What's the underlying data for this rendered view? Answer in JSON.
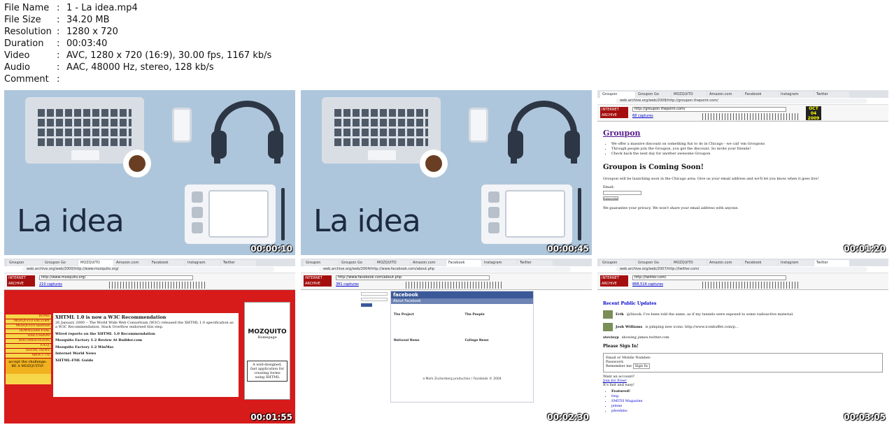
{
  "metadata": [
    {
      "key": "File Name",
      "value": "1 - La idea.mp4"
    },
    {
      "key": "File Size",
      "value": "34.20 MB"
    },
    {
      "key": "Resolution",
      "value": "1280 x 720"
    },
    {
      "key": "Duration",
      "value": "00:03:40"
    },
    {
      "key": "Video",
      "value": "AVC, 1280 x 720 (16:9), 30.00 fps, 1167 kb/s"
    },
    {
      "key": "Audio",
      "value": "AAC, 48000 Hz, stereo, 128 kb/s"
    },
    {
      "key": "Comment",
      "value": ""
    }
  ],
  "thumbnails": [
    {
      "timestamp": "00:00:10",
      "title": "La idea"
    },
    {
      "timestamp": "00:00:45",
      "title": "La idea"
    },
    {
      "timestamp": "00:01:20",
      "tabs": [
        "Groupon",
        "Groupon Go",
        "MOZQUITO",
        "Amazon.com",
        "Facebook",
        "Instagram",
        "Twitter"
      ],
      "address": "web.archive.org/web/2008/http://groupon.thepoint.com/",
      "wayback_url": "http://groupon.thepoint.com/",
      "captures": "68 captures",
      "wayback_date": "OCT 04 2009",
      "heading_link": "Groupon",
      "bullets": [
        "We offer a massive discount on something fun to do in Chicago - we call 'em Groupons",
        "Through people join the Groupon, you get the discount. So invite your friends!",
        "Check back the next day for another awesome Groupon"
      ],
      "heading": "Groupon is Coming Soon!",
      "paragraph": "Groupon will be launching soon in the Chicago area. Give us your email address and we'll let you know when it goes live!",
      "email_label": "Email:",
      "subscribe": "Subscribe",
      "privacy": "We guarantee your privacy. We won't share your email address with anyone."
    },
    {
      "timestamp": "00:01:55",
      "tabs": [
        "Groupon",
        "Groupon Go",
        "MOZQUITO",
        "Amazon.com",
        "Facebook",
        "Instagram",
        "Twitter"
      ],
      "address": "web.archive.org/web/2000/http://www.mozquito.org/",
      "wayback_url": "http://www.mozquito.org/",
      "captures": "210 captures",
      "nav": [
        "HOME",
        "MOZQUITO FACTORY",
        "MOZQUITO SERVER",
        "DOWNLOAD EVAL",
        "DISCUSSION",
        "DOCUMENTATION",
        "F.A.Q.",
        "XHTML NEWS",
        "ABOUT US"
      ],
      "headline": "XHTML 1.0 is now a W3C Recommendation",
      "body": "26 January 2000 -- The World Wide Web Consortium (W3C) released the XHTML 1.0 specification as a W3C Recommendation. Stack Overflow endorsed this step.",
      "item1": "Wired reports on the XHTML 1.0 Recommendation",
      "item2": "Mozquito Factory 1.2 Review At Builder.com",
      "item3": "Mozquito Factory 1.2 WinMac",
      "item4": "Internet World News",
      "item5": "XHTML-FML Guide",
      "logo": "MOZQUITO",
      "logo_sub": "Homepage",
      "ad": "A well-designed, fast application for creating forms using XHTML",
      "challenge": "accept the challenge: BE A MOZQUITO!"
    },
    {
      "timestamp": "00:02:30",
      "tabs": [
        "Groupon",
        "Groupon Go",
        "MOZQUITO",
        "Amazon.com",
        "Facebook",
        "Instagram",
        "Twitter"
      ],
      "address": "web.archive.org/web/2004/http://www.facebook.com/about.php",
      "wayback_url": "http://www.facebook.com/about.php",
      "captures": "381 captures",
      "fb_logo": "facebook",
      "fb_bar": "About Facebook",
      "fb_project": "The Project",
      "fb_people": "The People",
      "fb_national": "National News",
      "fb_college": "College News",
      "fb_footer": "a Mark Zuckerberg production / Facebook © 2004"
    },
    {
      "timestamp": "00:03:05",
      "tabs": [
        "Groupon",
        "Groupon Go",
        "MOZQUITO",
        "Amazon.com",
        "Facebook",
        "Instagram",
        "Twitter"
      ],
      "address": "web.archive.org/web/2007/http://twitter.com/",
      "wayback_url": "http://twitter.com/",
      "captures": "888,514 captures",
      "recent": "Recent Public Updates",
      "u1_name": "Erik",
      "u1_text": "@Snook: I've been told the same, as if my tunnels were exposed to some radioactive material.",
      "u2_name": "Josh Williams",
      "u2_text": "is pimping new icons: http://www.iconbuffet.com/p...",
      "u3_name": "stevieyp",
      "u3_text": "showing james.twitter.com",
      "signin": "Please Sign In!",
      "email_label": "Email or Mobile Number:",
      "password_label": "Password:",
      "remember": "Remember me",
      "signin_btn": "Sign In",
      "want": "Want an account?",
      "join": "Join for Free!",
      "fast": "It's fast and easy!",
      "featured": "Featured!",
      "featured_items": [
        "ting",
        "SMITH Magazine",
        "jelene",
        "phoekins"
      ]
    }
  ]
}
